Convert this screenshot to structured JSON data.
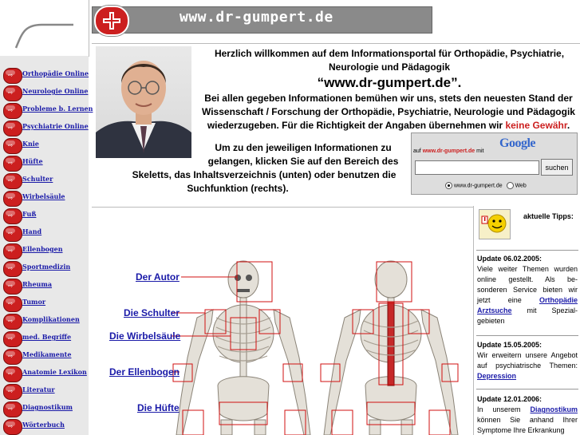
{
  "brand": {
    "site_title": "www.dr-gumpert.de"
  },
  "sidebar": {
    "items": [
      {
        "label": "Orthopädie Online"
      },
      {
        "label": "Neurologie Online"
      },
      {
        "label": "Probleme b. Lernen"
      },
      {
        "label": "Psychiatrie Online"
      },
      {
        "label": "Knie"
      },
      {
        "label": "Hüfte"
      },
      {
        "label": "Schulter"
      },
      {
        "label": "Wirbelsäule"
      },
      {
        "label": "Fuß"
      },
      {
        "label": "Hand"
      },
      {
        "label": "Ellenbogen"
      },
      {
        "label": "Sportmedizin"
      },
      {
        "label": "Rheuma"
      },
      {
        "label": "Tumor"
      },
      {
        "label": "Komplikationen"
      },
      {
        "label": "med. Begriffe"
      },
      {
        "label": "Medikamente"
      },
      {
        "label": "Anatomie Lexikon"
      },
      {
        "label": "Literatur"
      },
      {
        "label": "Diagnostikum"
      },
      {
        "label": "Wörterbuch"
      }
    ]
  },
  "welcome": {
    "line1": "Herzlich willkommen auf dem Informationsportal für Orthopädie, Psychiatrie,",
    "line2": "Neurologie und Pädagogik",
    "site_quote": "“www.dr-gumpert.de”.",
    "para1_l1": "Bei allen gegeben Informationen bemühen wir uns, stets den neuesten Stand der",
    "para1_l2": "Wissenschaft / Forschung der Orthopädie, Psychiatrie, Neurologie und Pädagogik",
    "para1_l3": "wiederzugeben. Für die Richtigkeit der Angaben übernehmen wir",
    "no_warranty": "keine Gewähr",
    "para1_end": ".",
    "para2_l1": "Um zu den jeweiligen Informationen zu",
    "para2_l2": "gelangen, klicken Sie auf den Bereich des",
    "para2_l3": "Skeletts, das Inhaltsverzeichnis (unten) oder benutzen die",
    "para2_l4": "Suchfunktion (rechts)."
  },
  "google": {
    "prefix": "auf",
    "site": "www.dr-gumpert.de",
    "suffix": "mit",
    "logo_text": "Google",
    "search_value": "",
    "search_button": "suchen",
    "radio_site": "www.dr-gumpert.de",
    "radio_web": "Web"
  },
  "skeleton": {
    "links": [
      "Der Autor",
      "Die Schulter",
      "Die Wirbelsäule",
      "Der Ellenbogen",
      "Die Hüfte"
    ]
  },
  "tips": {
    "header": "aktuelle Tipps:",
    "items": [
      {
        "title": "Update 06.02.2005:",
        "text_a": "Viele weiter Themen wurden online gestellt. Als be- sonderen Service bieten wir jetzt eine",
        "link": "Orthopädie Arztsuche",
        "text_b": "mit Spezial- gebieten"
      },
      {
        "title": "Update 15.05.2005:",
        "text_a": "Wir erweitern unsere Angebot auf psychiatrische Themen:",
        "link": "Depression",
        "text_b": ""
      },
      {
        "title": "Update 12.01.2006:",
        "text_a": "In unserem",
        "link": "Diagnostikum",
        "text_b": "können Sie anhand Ihrer Symptome Ihre Erkrankung"
      }
    ]
  },
  "colors": {
    "accent_red": "#cc1f1f",
    "link_blue": "#1a1aa8",
    "banner_gray": "#8a8a8a"
  }
}
